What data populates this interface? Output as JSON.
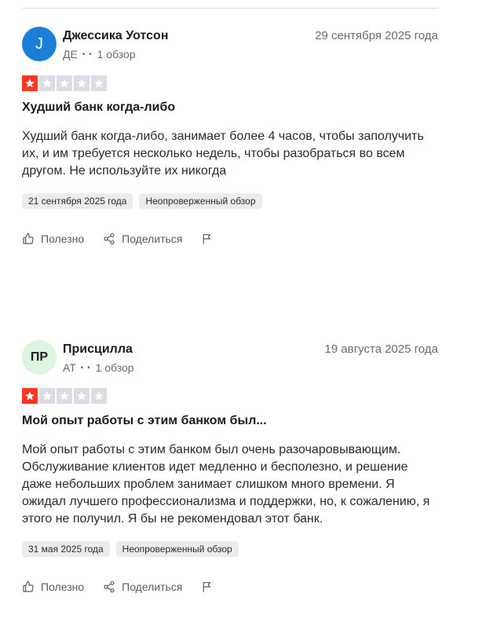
{
  "reviews": [
    {
      "avatar_text": "J",
      "avatar_bg": "#1a7fd6",
      "avatar_color": "#ffffff",
      "name": "Джессика Уотсон",
      "country": "ДЕ",
      "review_count": "1 обзор",
      "date": "29 сентября 2025 года",
      "rating": 1,
      "title": "Худший банк когда-либо",
      "text": "Худший банк когда-либо, занимает более 4 часов, чтобы заполучить их, и им требуется несколько недель, чтобы разобраться во всем другом. Не используйте их никогда",
      "experience_date": "21 сентября 2025 года",
      "verification": "Неопроверженный обзор",
      "helpful_label": "Полезно",
      "share_label": "Поделиться"
    },
    {
      "avatar_text": "ПР",
      "avatar_bg": "#dcf5e0",
      "avatar_color": "#1c1c1c",
      "name": "Присцилла",
      "country": "АТ",
      "review_count": "1 обзор",
      "date": "19 августа 2025 года",
      "rating": 1,
      "title": "Мой опыт работы с этим банком был...",
      "text": "Мой опыт работы с этим банком был очень разочаровывающим. Обслуживание клиентов идет медленно и бесполезно, и решение даже небольших проблем занимает слишком много времени. Я ожидал лучшего профессионализма и поддержки, но, к сожалению, я этого не получил. Я бы не рекомендовал этот банк.",
      "experience_date": "31 мая 2025 года",
      "verification": "Неопроверженный обзор",
      "helpful_label": "Полезно",
      "share_label": "Поделиться"
    }
  ],
  "colors": {
    "star_filled": "#ff3722",
    "star_empty": "#dcdce6"
  }
}
